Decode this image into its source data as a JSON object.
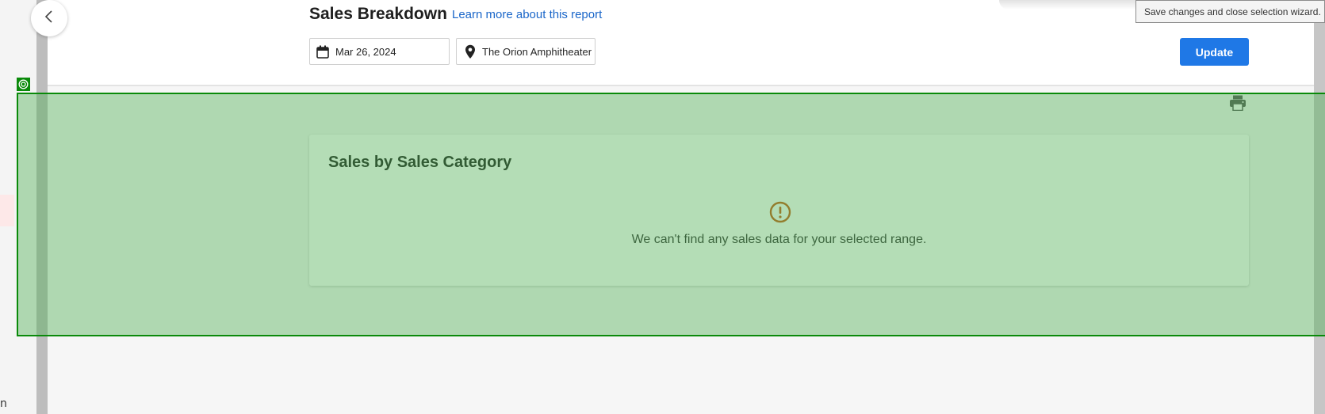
{
  "header": {
    "title": "Sales Breakdown",
    "learn_more": "Learn more about this report",
    "date_value": "Mar 26, 2024",
    "venue_value": "The Orion Amphitheater",
    "update_label": "Update"
  },
  "tooltip": {
    "text": "Save changes and close selection wizard."
  },
  "card": {
    "title": "Sales by Sales Category",
    "empty_message": "We can't find any sales data for your selected range."
  },
  "left_fragment": "n",
  "icons": {
    "back": "chevron-left-icon",
    "date": "calendar-icon",
    "venue": "location-pin-icon",
    "print": "printer-icon",
    "alert": "alert-circle-icon",
    "target": "target-icon"
  },
  "colors": {
    "accent": "#1f78e6",
    "link": "#1a66c9",
    "alert": "#c75a14",
    "selection_overlay": "#0a8a0a"
  }
}
